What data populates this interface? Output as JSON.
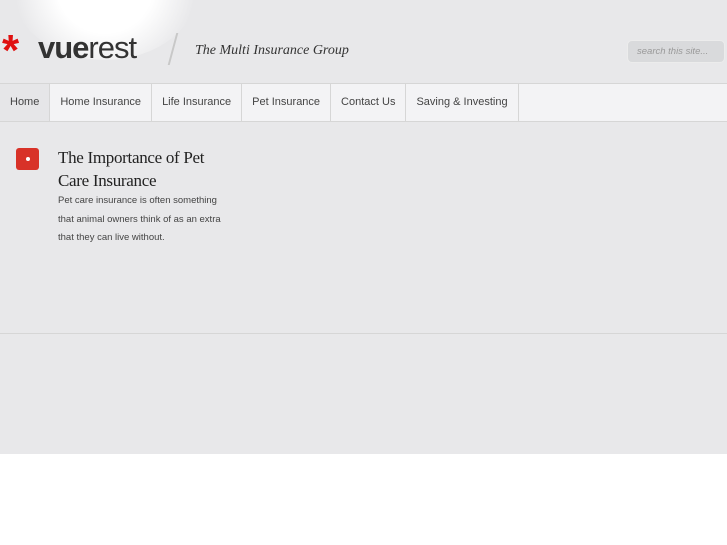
{
  "header": {
    "logo_mark": "*",
    "logo_bold": "vue",
    "logo_light": "rest",
    "tagline": "The Multi Insurance Group",
    "search_placeholder": "search this site..."
  },
  "nav": {
    "items": [
      {
        "label": "Home"
      },
      {
        "label": "Home Insurance"
      },
      {
        "label": "Life Insurance"
      },
      {
        "label": "Pet Insurance"
      },
      {
        "label": "Contact Us"
      },
      {
        "label": "Saving & Investing"
      }
    ]
  },
  "article": {
    "title": "The Importance of Pet Care Insurance",
    "excerpt": "Pet care insurance is often something that animal owners think of as an extra that they can live without."
  },
  "colors": {
    "accent": "#d83228"
  }
}
